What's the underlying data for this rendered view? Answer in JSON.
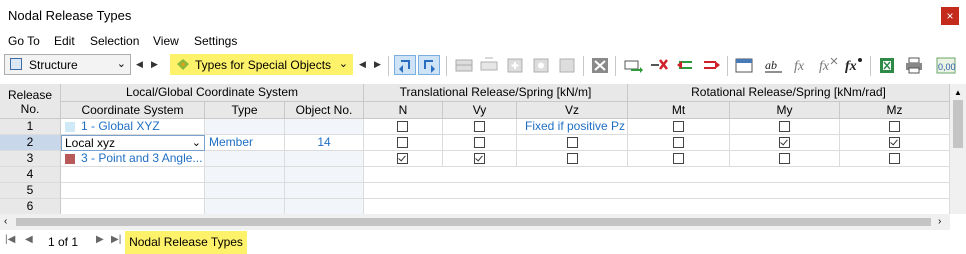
{
  "window": {
    "title": "Nodal Release Types",
    "close_glyph": "×"
  },
  "menu": [
    "Go To",
    "Edit",
    "Selection",
    "View",
    "Settings"
  ],
  "toolbar": {
    "structure_label": "Structure",
    "types_label": "Types for Special Objects",
    "highlight_color": "#fff26b"
  },
  "table": {
    "headers": {
      "release_no": [
        "Release",
        "No."
      ],
      "group_coord": "Local/Global Coordinate System",
      "coord_system": "Coordinate System",
      "type": "Type",
      "object_no": "Object No.",
      "group_trans": "Translational Release/Spring [kN/m]",
      "n": "N",
      "vy": "Vy",
      "vz": "Vz",
      "group_rot": "Rotational Release/Spring [kNm/rad]",
      "mt": "Mt",
      "my": "My",
      "mz": "Mz"
    },
    "rows": [
      {
        "no": "1",
        "coord": "1 - Global XYZ",
        "swatch": "#cfe9f7",
        "type": "",
        "object": "",
        "n": false,
        "vy": false,
        "vz": "Fixed if positive Pz",
        "mt": false,
        "my": false,
        "mz": false
      },
      {
        "no": "2",
        "coord": "Local xyz",
        "swatch": "",
        "type": "Member",
        "object": "14",
        "n": false,
        "vy": false,
        "vz": false,
        "mt": false,
        "my": true,
        "mz": true
      },
      {
        "no": "3",
        "coord": "3 - Point and 3 Angle...",
        "swatch": "#b85a5a",
        "type": "",
        "object": "",
        "n": true,
        "vy": true,
        "vz": false,
        "mt": false,
        "my": false,
        "mz": false
      },
      {
        "no": "4"
      },
      {
        "no": "5"
      },
      {
        "no": "6"
      }
    ]
  },
  "status": {
    "page": "1 of 1",
    "tab": "Nodal Release Types"
  }
}
